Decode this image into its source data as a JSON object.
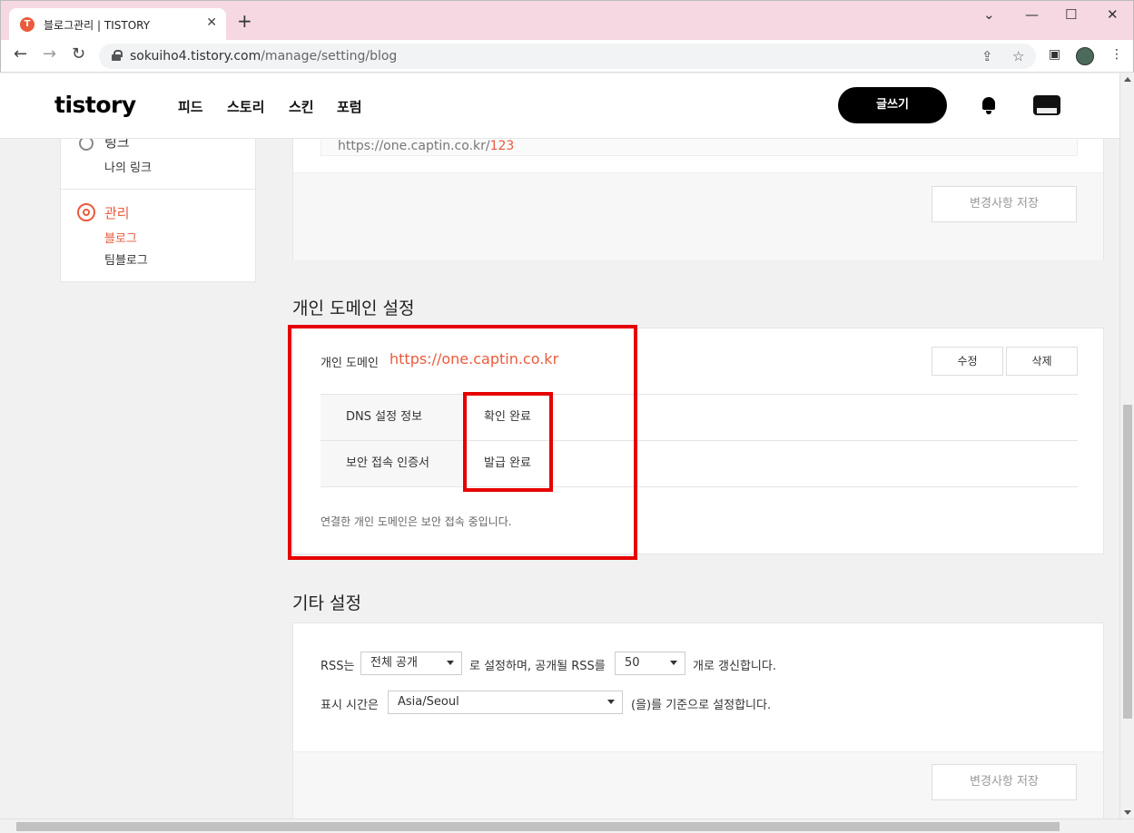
{
  "browser": {
    "tab_title": "블로그관리 | TISTORY",
    "tab_favicon": "T",
    "url_host": "sokuiho4.tistory.com",
    "url_path": "/manage/setting/blog"
  },
  "header": {
    "logo": "tistory",
    "nav": [
      "피드",
      "스토리",
      "스킨",
      "포럼"
    ],
    "write_label": "글쓰기"
  },
  "sidebar": {
    "link_title": "링크",
    "link_sub": "나의 링크",
    "manage_title": "관리",
    "manage_items": [
      "블로그",
      "팀블로그"
    ]
  },
  "url_card": {
    "url_prefix": "https://one.captin.co.kr/",
    "url_num": "123",
    "save_label": "변경사항 저장"
  },
  "domain_section": {
    "title": "개인 도메인 설정",
    "label": "개인 도메인",
    "url": "https://one.captin.co.kr",
    "edit_label": "수정",
    "delete_label": "삭제",
    "rows": [
      {
        "key": "DNS 설정 정보",
        "value": "확인 완료"
      },
      {
        "key": "보안 접속 인증서",
        "value": "발급 완료"
      }
    ],
    "note": "연결한 개인 도메인은 보안 접속 중입니다."
  },
  "other_section": {
    "title": "기타 설정",
    "rss_prefix": "RSS는",
    "rss_select": "전체 공개",
    "rss_middle": "로 설정하며, 공개될 RSS를",
    "rss_count": "50",
    "rss_suffix": "개로 갱신합니다.",
    "time_prefix": "표시 시간은",
    "time_select": "Asia/Seoul",
    "time_suffix": "(을)를 기준으로 설정합니다.",
    "save_label": "변경사항 저장"
  },
  "colors": {
    "accent": "#eb5a3c",
    "highlight_box": "#e60000"
  }
}
